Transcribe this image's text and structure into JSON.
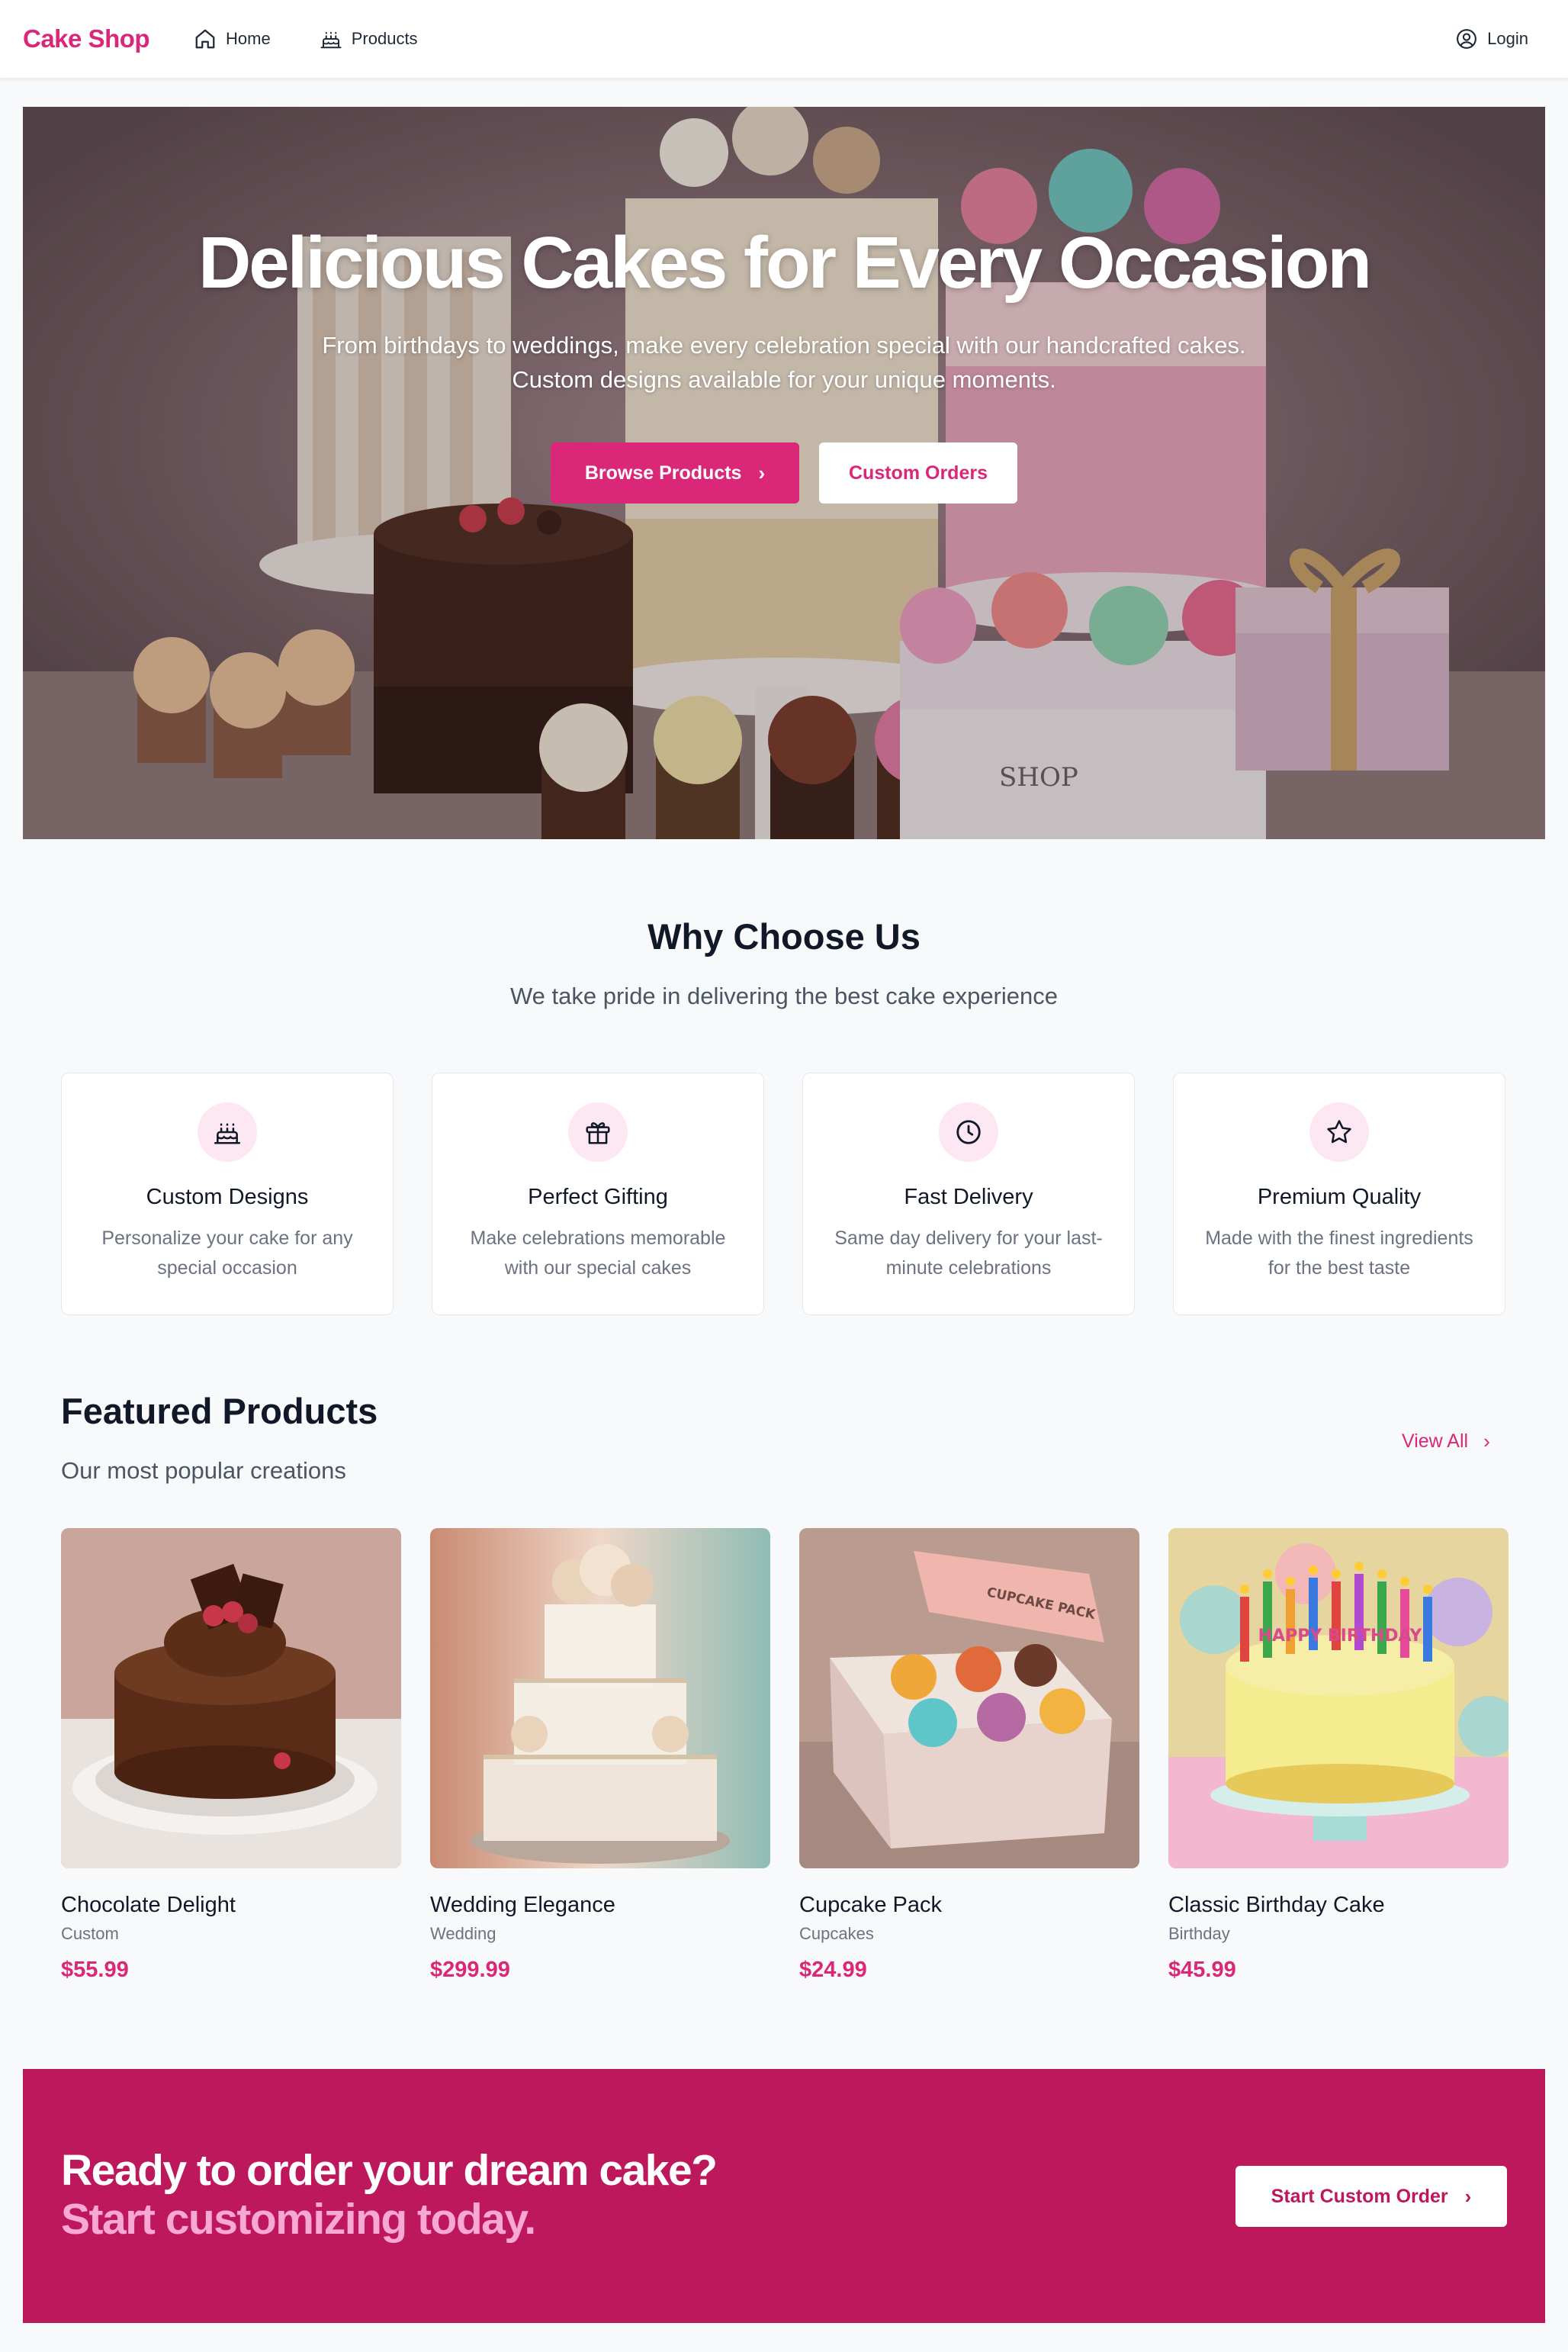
{
  "nav": {
    "brand": "Cake Shop",
    "home": "Home",
    "products": "Products",
    "login": "Login"
  },
  "hero": {
    "title": "Delicious Cakes for Every Occasion",
    "subtitle": "From birthdays to weddings, make every celebration special with our handcrafted cakes. Custom designs available for your unique moments.",
    "primary_button": "Browse Products",
    "secondary_button": "Custom Orders",
    "box_label": "SHOP"
  },
  "why": {
    "title": "Why Choose Us",
    "subtitle": "We take pride in delivering the best cake experience",
    "features": [
      {
        "icon": "cake-icon",
        "title": "Custom Designs",
        "desc": "Personalize your cake for any special occasion"
      },
      {
        "icon": "gift-icon",
        "title": "Perfect Gifting",
        "desc": "Make celebrations memorable with our special cakes"
      },
      {
        "icon": "clock-icon",
        "title": "Fast Delivery",
        "desc": "Same day delivery for your last-minute celebrations"
      },
      {
        "icon": "star-icon",
        "title": "Premium Quality",
        "desc": "Made with the finest ingredients for the best taste"
      }
    ]
  },
  "featured": {
    "title": "Featured Products",
    "subtitle": "Our most popular creations",
    "view_all": "View All",
    "products": [
      {
        "name": "Chocolate Delight",
        "category": "Custom",
        "price": "$55.99"
      },
      {
        "name": "Wedding Elegance",
        "category": "Wedding",
        "price": "$299.99"
      },
      {
        "name": "Cupcake Pack",
        "category": "Cupcakes",
        "price": "$24.99",
        "box_label": "CUPCAKE PACK"
      },
      {
        "name": "Classic Birthday Cake",
        "category": "Birthday",
        "price": "$45.99",
        "cake_text": "HAPPY BIRTHDAY"
      }
    ]
  },
  "cta": {
    "line1": "Ready to order your dream cake?",
    "line2": "Start customizing today.",
    "button": "Start Custom Order"
  },
  "colors": {
    "accent": "#db2777",
    "cta_bg": "#be185d",
    "cta_highlight": "#f9a8d4",
    "icon_bg": "#fce7f3"
  }
}
